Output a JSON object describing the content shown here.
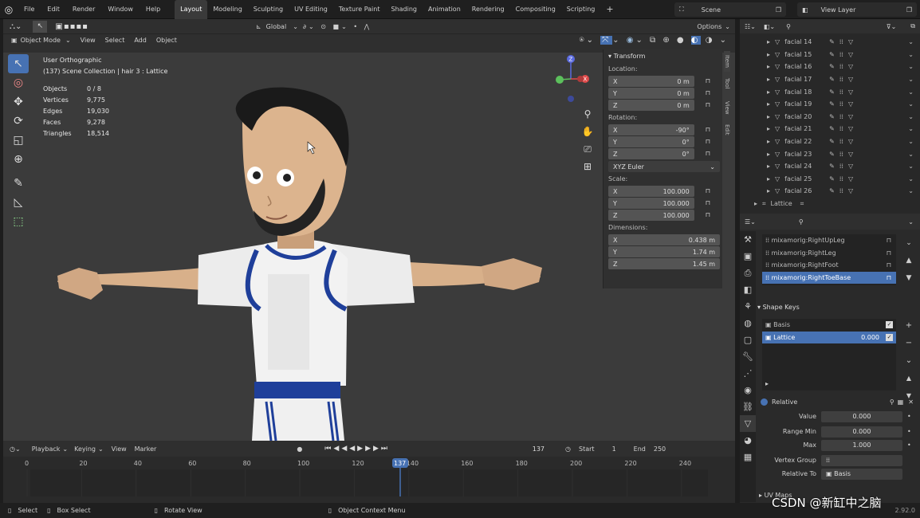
{
  "topbar": {
    "menus": [
      "File",
      "Edit",
      "Render",
      "Window",
      "Help"
    ],
    "workspaces": [
      "Layout",
      "Modeling",
      "Sculpting",
      "UV Editing",
      "Texture Paint",
      "Shading",
      "Animation",
      "Rendering",
      "Compositing",
      "Scripting"
    ],
    "active_workspace": "Layout",
    "plus": "+",
    "scene": "Scene",
    "view_layer": "View Layer"
  },
  "viewport": {
    "mode": "Object Mode",
    "menus": [
      "View",
      "Select",
      "Add",
      "Object"
    ],
    "orientation": "Global",
    "options": "Options",
    "view_name": "User Orthographic",
    "collection": "(137) Scene Collection | hair 3 : Lattice",
    "stats": [
      {
        "k": "Objects",
        "v": "0 / 8"
      },
      {
        "k": "Vertices",
        "v": "9,775"
      },
      {
        "k": "Edges",
        "v": "19,030"
      },
      {
        "k": "Faces",
        "v": "9,278"
      },
      {
        "k": "Triangles",
        "v": "18,514"
      }
    ],
    "gizmo": {
      "x": "X",
      "y": "Y",
      "z": "Z"
    }
  },
  "npanel": {
    "title": "Transform",
    "tabs": [
      "Item",
      "Tool",
      "View",
      "Edit"
    ],
    "location_label": "Location:",
    "location": [
      {
        "a": "X",
        "v": "0 m"
      },
      {
        "a": "Y",
        "v": "0 m"
      },
      {
        "a": "Z",
        "v": "0 m"
      }
    ],
    "rotation_label": "Rotation:",
    "rotation": [
      {
        "a": "X",
        "v": "-90°"
      },
      {
        "a": "Y",
        "v": "0°"
      },
      {
        "a": "Z",
        "v": "0°"
      }
    ],
    "rotation_mode": "XYZ Euler",
    "scale_label": "Scale:",
    "scale": [
      {
        "a": "X",
        "v": "100.000"
      },
      {
        "a": "Y",
        "v": "100.000"
      },
      {
        "a": "Z",
        "v": "100.000"
      }
    ],
    "dimensions_label": "Dimensions:",
    "dimensions": [
      {
        "a": "X",
        "v": "0.438 m"
      },
      {
        "a": "Y",
        "v": "1.74 m"
      },
      {
        "a": "Z",
        "v": "1.45 m"
      }
    ]
  },
  "timeline": {
    "menus": [
      "Playback",
      "Keying",
      "View",
      "Marker"
    ],
    "current": "137",
    "start_label": "Start",
    "start": "1",
    "end_label": "End",
    "end": "250",
    "ticks": [
      "0",
      "20",
      "40",
      "60",
      "80",
      "100",
      "120",
      "140",
      "160",
      "180",
      "200",
      "220",
      "240"
    ],
    "playhead_label": "137"
  },
  "status": {
    "select": "Select",
    "box_select": "Box Select",
    "rotate_view": "Rotate View",
    "context_menu": "Object Context Menu",
    "version": "2.92.0"
  },
  "outliner": {
    "items": [
      "facial 14",
      "facial 15",
      "facial 16",
      "facial 17",
      "facial 18",
      "facial 19",
      "facial 20",
      "facial 21",
      "facial 22",
      "facial 23",
      "facial 24",
      "facial 25",
      "facial 26"
    ],
    "lattice": "Lattice"
  },
  "properties": {
    "vertex_groups": [
      "mixamorig:RightUpLeg",
      "mixamorig:RightLeg",
      "mixamorig:RightFoot",
      "mixamorig:RightToeBase"
    ],
    "shape_keys_title": "Shape Keys",
    "shape_keys": [
      {
        "name": "Basis",
        "value": ""
      },
      {
        "name": "Lattice",
        "value": "0.000"
      }
    ],
    "relative": "Relative",
    "value_label": "Value",
    "value": "0.000",
    "range_min_label": "Range Min",
    "range_min": "0.000",
    "max_label": "Max",
    "max": "1.000",
    "vertex_group_label": "Vertex Group",
    "relative_to_label": "Relative To",
    "relative_to": "Basis",
    "uv_maps": "UV Maps"
  },
  "watermark": "CSDN @新缸中之脑",
  "colors": {
    "accent": "#4772b3",
    "bg": "#3b3b3b",
    "skin": "#dcb48e",
    "hair": "#1a1a1a",
    "jersey_blue": "#1f3f9a"
  }
}
